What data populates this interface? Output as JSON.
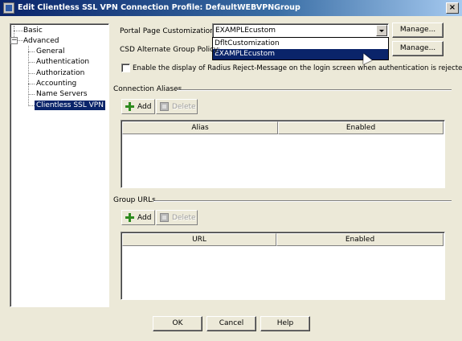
{
  "window": {
    "title": "Edit Clientless SSL VPN Connection Profile: DefaultWEBVPNGroup",
    "close_glyph": "×"
  },
  "tree": {
    "basic": "Basic",
    "advanced": "Advanced",
    "expander_glyph": "−",
    "children": [
      "General",
      "Authentication",
      "Authorization",
      "Accounting",
      "Name Servers",
      "Clientless SSL VPN"
    ],
    "selected": "Clientless SSL VPN"
  },
  "portal": {
    "label": "Portal Page Customization:",
    "value": "EXAMPLEcustom",
    "manage_label": "Manage...",
    "options": [
      "DfltCustomization",
      "EXAMPLEcustom"
    ],
    "highlighted_option": "EXAMPLEcustom"
  },
  "csd": {
    "label": "CSD Alternate Group Policy:",
    "manage_label": "Manage..."
  },
  "radius": {
    "label": "Enable the display of Radius Reject-Message on the login screen when authentication is rejected",
    "checked": false
  },
  "aliases": {
    "title": "Connection Aliases",
    "add_label": "Add",
    "delete_label": "Delete",
    "columns": [
      "Alias",
      "Enabled"
    ],
    "rows": []
  },
  "urls": {
    "title": "Group URLs",
    "add_label": "Add",
    "delete_label": "Delete",
    "columns": [
      "URL",
      "Enabled"
    ],
    "rows": []
  },
  "buttons": {
    "ok": "OK",
    "cancel": "Cancel",
    "help": "Help"
  },
  "icons": {
    "add": "green-plus-icon",
    "delete": "delete-icon",
    "app": "app-icon"
  }
}
